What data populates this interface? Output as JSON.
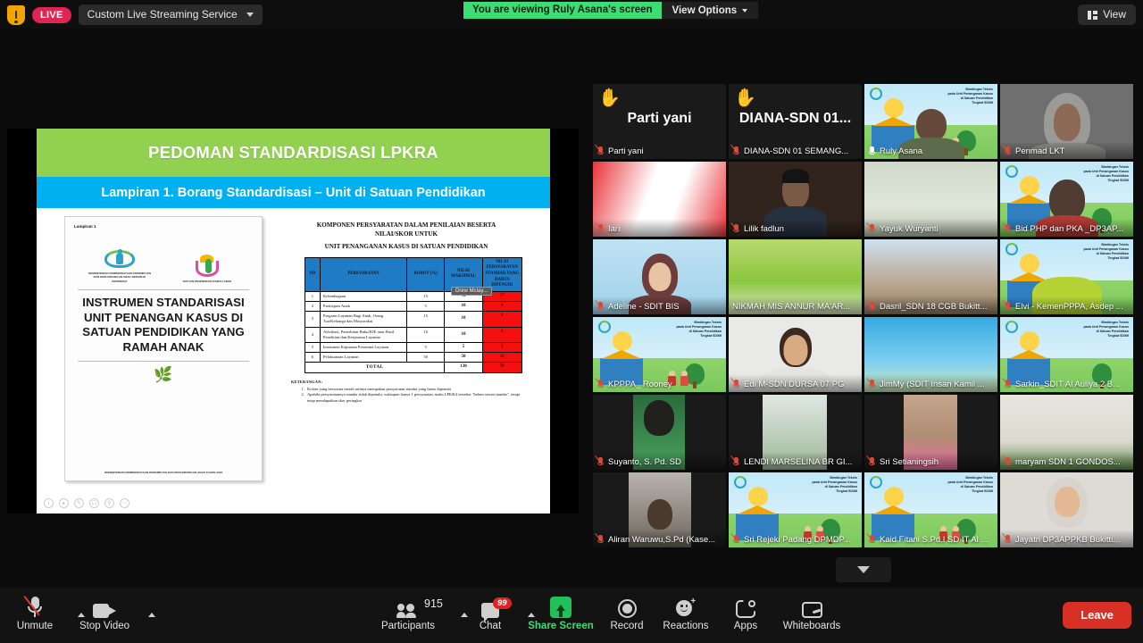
{
  "topbar": {
    "shield_icon": "security-shield-icon",
    "live_label": "LIVE",
    "stream_service": "Custom Live Streaming Service",
    "viewing_banner": "You are viewing Ruly Asana's screen",
    "view_options": "View Options",
    "view_button": "View"
  },
  "share": {
    "slide_title": "PEDOMAN STANDARDISASI LPKRA",
    "slide_subtitle": "Lampiran 1. Borang Standardisasi – Unit di Satuan Pendidikan",
    "cursor_tag": "Drew Mclay...",
    "document": {
      "lampiran": "Lampiran 1",
      "logo_left_caption": "KEMENTERIAN PEMBERDAYAAN PEREMPUAN DAN PERLINDUNGAN ANAK REPUBLIK INDONESIA",
      "logo_right_caption": "SATUAN PENDIDIKAN RAMAH ANAK",
      "title": "INSTRUMEN STANDARISASI UNIT PENANGAN KASUS DI SATUAN PENDIDIKAN YANG RAMAH ANAK",
      "footer": "KEMENTERIAN PEMBERDAYAAN PEREMPUAN DAN PERLINDUNGAN ANAK TAHUN 2022"
    },
    "table": {
      "heading_line1": "KOMPONEN PERSYARATAN DALAM PENILAIAN BESERTA",
      "heading_line2": "NILAI/SKOR UNTUK",
      "heading_line3": "UNIT PENANGANAN KASUS DI SATUAN PENDIDIKAN",
      "columns": [
        "NO",
        "PERSYARATAN",
        "BOBOT (%)",
        "NILAI MAKSIMAL",
        "NILAI PERSYARATAN STANDAR YANG HARUS DIPENUHI"
      ],
      "rows": [
        {
          "no": "1",
          "persyaratan": "Kelembagaan",
          "bobot": "15",
          "nilai_maksimal": "45",
          "nilai_standar": "27"
        },
        {
          "no": "2",
          "persyaratan": "Partisipasi Anak",
          "bobot": "5",
          "nilai_maksimal": "10",
          "nilai_standar": "8"
        },
        {
          "no": "3",
          "persyaratan": "Program Layanan Bagi Anak, Orang Tua/Keluarga dan Masyarakat",
          "bobot": "15",
          "nilai_maksimal": "10",
          "nilai_standar": "6"
        },
        {
          "no": "4",
          "persyaratan": "Advokasi, Penerbitan Buku/KIE atau Hasil Penelitian dan Kerjasama Layanan",
          "bobot": "10",
          "nilai_maksimal": "10",
          "nilai_standar": "6"
        },
        {
          "no": "5",
          "persyaratan": "Instrumen Kepuasan Penerima Layanan",
          "bobot": "5",
          "nilai_maksimal": "5",
          "nilai_standar": "5"
        },
        {
          "no": "6",
          "persyaratan": "Pelaksanaan Layanan",
          "bobot": "50",
          "nilai_maksimal": "50",
          "nilai_standar": "26"
        }
      ],
      "total": {
        "label": "TOTAL",
        "nilai_maksimal": "130",
        "nilai_standar": "78"
      }
    },
    "keterangan": {
      "title": "KETERANGAN:",
      "items": [
        "Kolom yang berwarna merah artinya merupakan persyaratan standar yang harus dipenuhi",
        "Apabila persyaratannya standar tidak dipenuhi, walaupun hanya 1 persyaratan, maka LPKRA tersebut \"belum sesuai standar\", tetapi tetap mendapatkan skor peringkat"
      ]
    },
    "mini_tools": [
      "info-icon",
      "pointer-icon",
      "pen-icon",
      "camera-icon",
      "zoom-icon",
      "more-icon"
    ]
  },
  "grid": {
    "rows": [
      [
        {
          "name": "Parti yani",
          "big_name": "Parti yani",
          "hand_raised": true,
          "muted": true,
          "placeholder": true,
          "active": false
        },
        {
          "name": "DIANA-SDN 01 SEMANG...",
          "big_name": "DIANA-SDN  01...",
          "hand_raised": true,
          "muted": true,
          "placeholder": true,
          "active": false
        },
        {
          "name": "Ruly Asana",
          "bg": "sra",
          "person": true,
          "muted": false,
          "active": true
        },
        {
          "name": "Penmad LKT",
          "person": true,
          "muted": true,
          "active": false
        }
      ],
      [
        {
          "name": "Iari",
          "bg": "red",
          "muted": true,
          "active": false
        },
        {
          "name": "Lilik fadlun",
          "person": true,
          "bg": "dark",
          "muted": true,
          "active": false
        },
        {
          "name": "Yayuk Wuryanti",
          "bg": "room",
          "muted": true,
          "active": false
        },
        {
          "name": "Bid PHP dan PKA _DP3AP...",
          "bg": "sra",
          "person": true,
          "muted": true,
          "active": false
        }
      ],
      [
        {
          "name": "Adeline - SDIT BIS",
          "person": true,
          "bg": "blue",
          "muted": true,
          "active": false
        },
        {
          "name": "NIKMAH MIS ANNUR MA'AR...",
          "bg": "green",
          "muted": false,
          "active": false
        },
        {
          "name": "Dasril_SDN 18 CGB Bukitt...",
          "bg": "photo",
          "muted": true,
          "active": false
        },
        {
          "name": "Elvi - KemenPPPA, Asdep ...",
          "bg": "sra",
          "muted": true,
          "active": false
        }
      ],
      [
        {
          "name": "KPPPA_ Rooney",
          "bg": "sra",
          "muted": true,
          "active": false
        },
        {
          "name": "Edi M-SDN DURSA 07 PG",
          "person": true,
          "bg": "white",
          "muted": true,
          "active": false
        },
        {
          "name": "JimMy (SDIT Insan Kamil ...",
          "bg": "insan",
          "muted": true,
          "active": false
        },
        {
          "name": "Sarkin_SDIT Al Auliya 2 B...",
          "bg": "sra",
          "muted": true,
          "active": false
        }
      ],
      [
        {
          "name": "Suyanto, S. Pd. SD",
          "bg": "narrow",
          "muted": true,
          "active": false
        },
        {
          "name": "LENDI MARSELINA BR GI...",
          "bg": "plant",
          "muted": true,
          "active": false
        },
        {
          "name": "Sri Setianingsih",
          "bg": "narrow2",
          "muted": true,
          "active": false
        },
        {
          "name": "maryam SDN 1 GONDOS...",
          "bg": "board",
          "muted": true,
          "active": false
        }
      ],
      [
        {
          "name": "Aliran Waruwu,S.Pd (Kase...",
          "bg": "window",
          "muted": true,
          "active": false
        },
        {
          "name": "Sri Rejeki Padang DPMDP...",
          "bg": "sra",
          "muted": true,
          "active": false
        },
        {
          "name": "Kaid Fitani  S.Pd.I SD IT Al ...",
          "bg": "sra",
          "muted": true,
          "active": false
        },
        {
          "name": "Jayatri DP3APPKB Bukitti...",
          "person": true,
          "bg": "white",
          "muted": true,
          "active": false
        }
      ]
    ],
    "scroll_down_icon": "chevron-down-icon"
  },
  "toolbar": {
    "unmute": "Unmute",
    "stop_video": "Stop Video",
    "participants": "Participants",
    "participants_count": "915",
    "chat": "Chat",
    "chat_badge": "99",
    "share_screen": "Share Screen",
    "record": "Record",
    "reactions": "Reactions",
    "apps": "Apps",
    "whiteboards": "Whiteboards",
    "leave": "Leave"
  },
  "colors": {
    "live_red": "#e02454",
    "share_green": "#3ddc74",
    "leave_red": "#d93025",
    "slide_green": "#92d050",
    "slide_blue": "#00b0f0",
    "table_header_blue": "#1f7bc4",
    "table_required_red": "#f60f0f",
    "active_speaker_border": "#d9e021"
  }
}
